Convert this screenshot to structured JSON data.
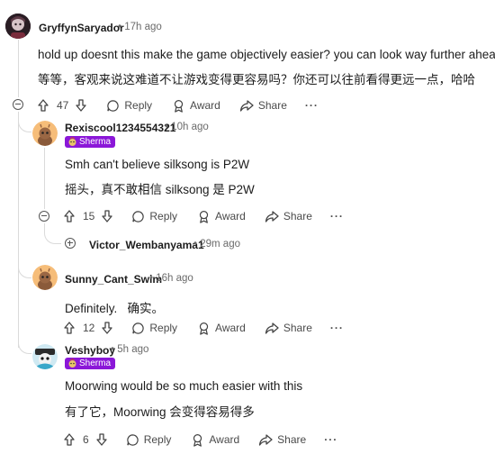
{
  "comments": [
    {
      "username": "GryffynSaryador",
      "time": "17h ago",
      "lines": [
        "hold up doesnt this make the game objectively easier? you can look way further ahead lol",
        "等等，客观来说这难道不让游戏变得更容易吗？你还可以往前看得更远一点，哈哈"
      ],
      "votes": "47"
    },
    {
      "username": "Rexiscool1234554321",
      "time": "10h ago",
      "flair": "Sherma",
      "lines": [
        "Smh can't believe silksong is P2W",
        "摇头，真不敢相信 silksong 是 P2W"
      ],
      "votes": "15"
    },
    {
      "username": "Victor_Wembanyama1",
      "time": "29m ago"
    },
    {
      "username": "Sunny_Cant_Swim",
      "time": "16h ago",
      "lines": [
        "Definitely.   确实。"
      ],
      "votes": "12"
    },
    {
      "username": "Veshyboy",
      "time": "5h ago",
      "flair": "Sherma",
      "lines": [
        "Moorwing would be so much easier with this",
        "有了它，Moorwing 会变得容易得多"
      ],
      "votes": "6"
    }
  ],
  "labels": {
    "reply": "Reply",
    "award": "Award",
    "share": "Share",
    "more": "···",
    "sep": "•"
  }
}
